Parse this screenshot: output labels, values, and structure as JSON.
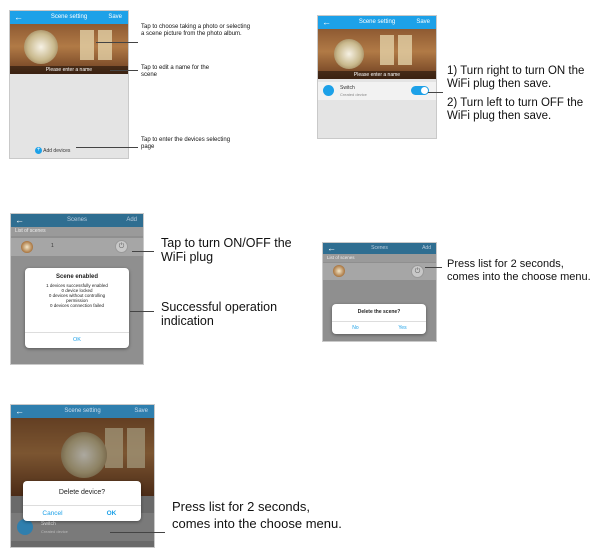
{
  "p1": {
    "back_icon": "arrow-left-icon",
    "title": "Scene setting",
    "save": "Save",
    "name_placeholder": "Please enter a name",
    "add_devices": "Add devices",
    "callout_photo": "Tap to choose taking a photo or selecting a scene picture from the photo album.",
    "callout_name": "Tap to edit a name for the scene",
    "callout_devices": "Tap to enter the devices selecting page"
  },
  "p2": {
    "title": "Scene setting",
    "save": "Save",
    "name_placeholder": "Please enter a name",
    "switch_label": "Switch",
    "switch_sub": "Created device",
    "switch_on": true,
    "note_1": "1) Turn right to turn ON the WiFi plug then save.",
    "note_2": "2) Turn left to turn OFF the WiFi plug then save."
  },
  "p3": {
    "title": "Scenes",
    "add": "Add",
    "list_header": "List of scenes",
    "item_label": "1",
    "dialog_title": "Scene enabled",
    "dialog_line_1": "1 devices successfully enabled",
    "dialog_line_2": "0 device locked",
    "dialog_line_3": "0 devices without controlling permission",
    "dialog_line_4": "0 devices connection failed",
    "dialog_ok": "OK",
    "callout_toggle": "Tap to turn ON/OFF the WiFi plug",
    "callout_success": "Successful operation indication"
  },
  "p4": {
    "title": "Scenes",
    "add": "Add",
    "list_header": "List of scenes",
    "dialog_title": "Delete the scene?",
    "no": "No",
    "yes": "Yes",
    "callout": "Press list for 2 seconds, comes into the choose menu."
  },
  "p5": {
    "title": "Scene setting",
    "save": "Save",
    "dialog_title": "Delete device?",
    "cancel": "Cancel",
    "ok": "OK",
    "device_label": "Switch",
    "device_sub": "Created device",
    "callout_line_1": "Press list for 2 seconds,",
    "callout_line_2": "comes into the choose menu."
  },
  "colors": {
    "accent": "#1da1e8",
    "dark_header": "#2f6e91"
  }
}
